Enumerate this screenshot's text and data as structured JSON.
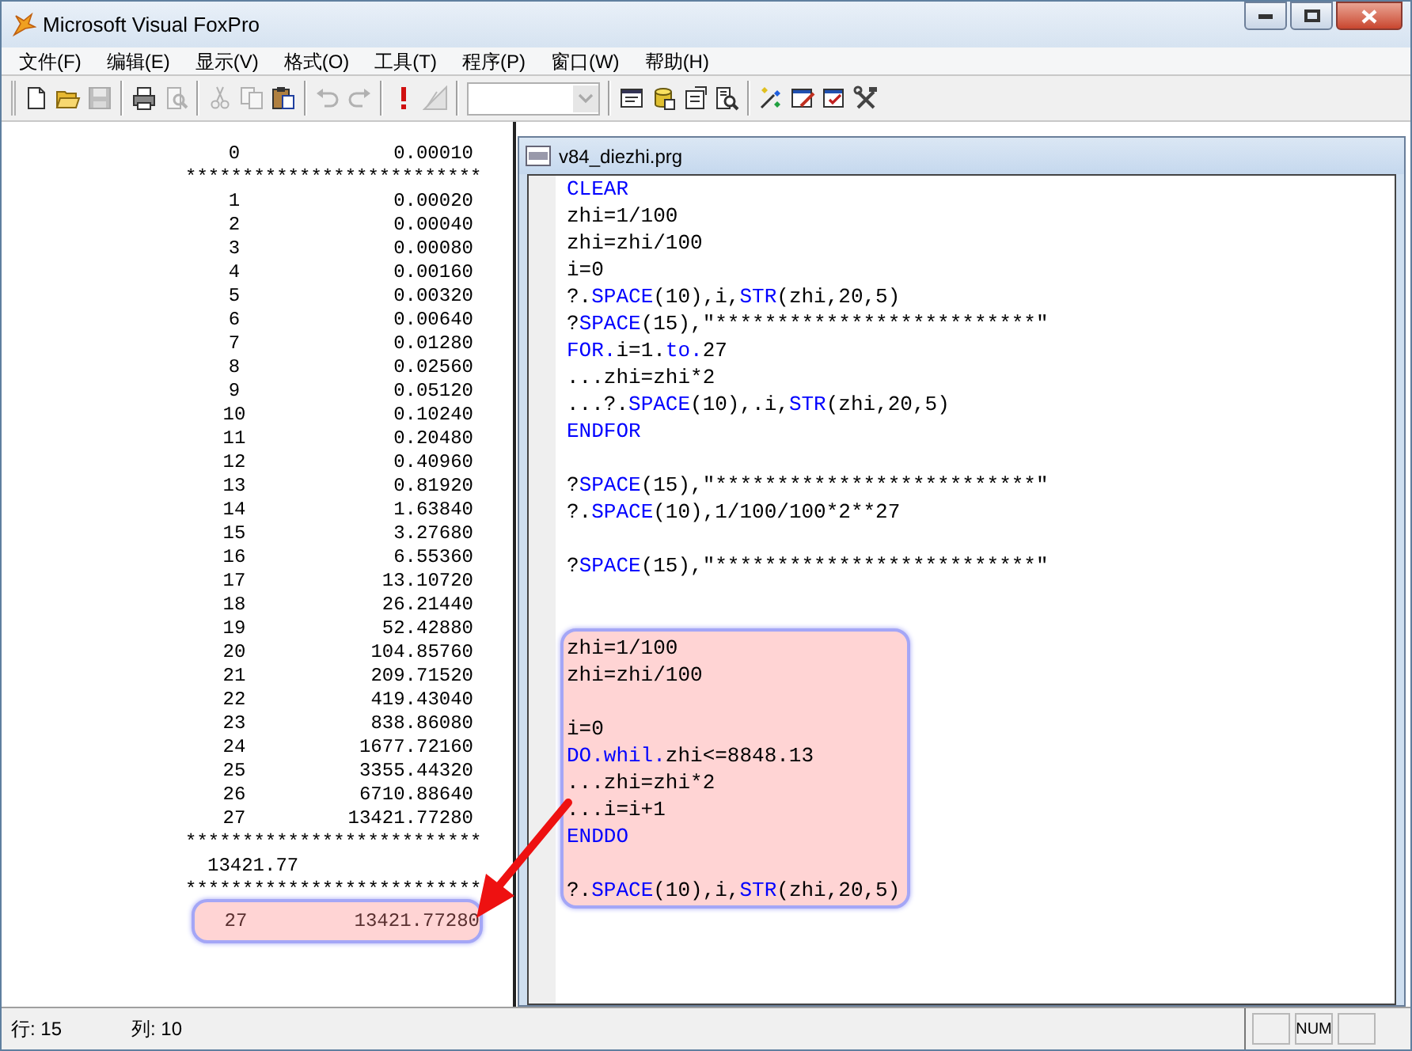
{
  "window": {
    "title": "Microsoft Visual FoxPro"
  },
  "menu": [
    "文件(F)",
    "编辑(E)",
    "显示(V)",
    "格式(O)",
    "工具(T)",
    "程序(P)",
    "窗口(W)",
    "帮助(H)"
  ],
  "toolbar": [
    {
      "kind": "new",
      "disabled": false
    },
    {
      "kind": "open",
      "disabled": false
    },
    {
      "kind": "save",
      "disabled": true
    },
    {
      "kind": "sep"
    },
    {
      "kind": "print",
      "disabled": false
    },
    {
      "kind": "preview",
      "disabled": true
    },
    {
      "kind": "sep"
    },
    {
      "kind": "cut",
      "disabled": true
    },
    {
      "kind": "copy",
      "disabled": true
    },
    {
      "kind": "paste",
      "disabled": false
    },
    {
      "kind": "sep"
    },
    {
      "kind": "undo",
      "disabled": true
    },
    {
      "kind": "redo",
      "disabled": true
    },
    {
      "kind": "sep"
    },
    {
      "kind": "run",
      "disabled": false
    },
    {
      "kind": "modify",
      "disabled": true
    },
    {
      "kind": "sep"
    },
    {
      "kind": "combo",
      "disabled": true
    },
    {
      "kind": "sep"
    },
    {
      "kind": "command",
      "disabled": false
    },
    {
      "kind": "database",
      "disabled": false
    },
    {
      "kind": "properties",
      "disabled": false
    },
    {
      "kind": "code",
      "disabled": false
    },
    {
      "kind": "sep"
    },
    {
      "kind": "wizard",
      "disabled": false
    },
    {
      "kind": "form",
      "disabled": false
    },
    {
      "kind": "formcheck",
      "disabled": false
    },
    {
      "kind": "tools",
      "disabled": false
    }
  ],
  "output": [
    {
      "kind": "row",
      "index": "0",
      "value": "0.00010",
      "highlighted": false
    },
    {
      "kind": "rule",
      "text": "**************************"
    },
    {
      "kind": "row",
      "index": "1",
      "value": "0.00020",
      "highlighted": false
    },
    {
      "kind": "row",
      "index": "2",
      "value": "0.00040",
      "highlighted": false
    },
    {
      "kind": "row",
      "index": "3",
      "value": "0.00080",
      "highlighted": false
    },
    {
      "kind": "row",
      "index": "4",
      "value": "0.00160",
      "highlighted": false
    },
    {
      "kind": "row",
      "index": "5",
      "value": "0.00320",
      "highlighted": false
    },
    {
      "kind": "row",
      "index": "6",
      "value": "0.00640",
      "highlighted": false
    },
    {
      "kind": "row",
      "index": "7",
      "value": "0.01280",
      "highlighted": false
    },
    {
      "kind": "row",
      "index": "8",
      "value": "0.02560",
      "highlighted": false
    },
    {
      "kind": "row",
      "index": "9",
      "value": "0.05120",
      "highlighted": false
    },
    {
      "kind": "row",
      "index": "10",
      "value": "0.10240",
      "highlighted": false
    },
    {
      "kind": "row",
      "index": "11",
      "value": "0.20480",
      "highlighted": false
    },
    {
      "kind": "row",
      "index": "12",
      "value": "0.40960",
      "highlighted": false
    },
    {
      "kind": "row",
      "index": "13",
      "value": "0.81920",
      "highlighted": false
    },
    {
      "kind": "row",
      "index": "14",
      "value": "1.63840",
      "highlighted": false
    },
    {
      "kind": "row",
      "index": "15",
      "value": "3.27680",
      "highlighted": false
    },
    {
      "kind": "row",
      "index": "16",
      "value": "6.55360",
      "highlighted": false
    },
    {
      "kind": "row",
      "index": "17",
      "value": "13.10720",
      "highlighted": false
    },
    {
      "kind": "row",
      "index": "18",
      "value": "26.21440",
      "highlighted": false
    },
    {
      "kind": "row",
      "index": "19",
      "value": "52.42880",
      "highlighted": false
    },
    {
      "kind": "row",
      "index": "20",
      "value": "104.85760",
      "highlighted": false
    },
    {
      "kind": "row",
      "index": "21",
      "value": "209.71520",
      "highlighted": false
    },
    {
      "kind": "row",
      "index": "22",
      "value": "419.43040",
      "highlighted": false
    },
    {
      "kind": "row",
      "index": "23",
      "value": "838.86080",
      "highlighted": false
    },
    {
      "kind": "row",
      "index": "24",
      "value": "1677.72160",
      "highlighted": false
    },
    {
      "kind": "row",
      "index": "25",
      "value": "3355.44320",
      "highlighted": false
    },
    {
      "kind": "row",
      "index": "26",
      "value": "6710.88640",
      "highlighted": false
    },
    {
      "kind": "row",
      "index": "27",
      "value": "13421.77280",
      "highlighted": false
    },
    {
      "kind": "rule",
      "text": "**************************"
    },
    {
      "kind": "total",
      "text": "13421.77"
    },
    {
      "kind": "rule",
      "text": "**************************"
    },
    {
      "kind": "row",
      "index": "27",
      "value": "13421.77280",
      "highlighted": true
    }
  ],
  "editor": {
    "title": "v84_diezhi.prg",
    "lines": [
      {
        "kind": "code",
        "segments": [
          {
            "text": "CLEAR",
            "kind": "kw"
          }
        ]
      },
      {
        "kind": "code",
        "segments": [
          {
            "text": "zhi=1/100",
            "kind": "plain"
          }
        ]
      },
      {
        "kind": "code",
        "segments": [
          {
            "text": "zhi=zhi/100",
            "kind": "plain"
          }
        ]
      },
      {
        "kind": "code",
        "segments": [
          {
            "text": "i=0",
            "kind": "plain"
          }
        ]
      },
      {
        "kind": "code",
        "segments": [
          {
            "text": "?.",
            "kind": "plain"
          },
          {
            "text": "SPACE",
            "kind": "kw"
          },
          {
            "text": "(10),i,",
            "kind": "plain"
          },
          {
            "text": "STR",
            "kind": "kw"
          },
          {
            "text": "(zhi,20,5)",
            "kind": "plain"
          }
        ]
      },
      {
        "kind": "code",
        "segments": [
          {
            "text": "?",
            "kind": "plain"
          },
          {
            "text": "SPACE",
            "kind": "kw"
          },
          {
            "text": "(15),″**************************″",
            "kind": "plain"
          }
        ]
      },
      {
        "kind": "code",
        "segments": [
          {
            "text": "FOR.",
            "kind": "kw"
          },
          {
            "text": "i=1.",
            "kind": "plain"
          },
          {
            "text": "to.",
            "kind": "kw"
          },
          {
            "text": "27",
            "kind": "plain"
          }
        ]
      },
      {
        "kind": "code",
        "segments": [
          {
            "text": "...zhi=zhi*2",
            "kind": "plain"
          }
        ]
      },
      {
        "kind": "code",
        "segments": [
          {
            "text": "...?.",
            "kind": "plain"
          },
          {
            "text": "SPACE",
            "kind": "kw"
          },
          {
            "text": "(10),.i,",
            "kind": "plain"
          },
          {
            "text": "STR",
            "kind": "kw"
          },
          {
            "text": "(zhi,20,5)",
            "kind": "plain"
          }
        ]
      },
      {
        "kind": "code",
        "segments": [
          {
            "text": "ENDFOR",
            "kind": "kw"
          }
        ]
      },
      {
        "kind": "blank"
      },
      {
        "kind": "code",
        "segments": [
          {
            "text": "?",
            "kind": "plain"
          },
          {
            "text": "SPACE",
            "kind": "kw"
          },
          {
            "text": "(15),″**************************″",
            "kind": "plain"
          }
        ]
      },
      {
        "kind": "code",
        "segments": [
          {
            "text": "?.",
            "kind": "plain"
          },
          {
            "text": "SPACE",
            "kind": "kw"
          },
          {
            "text": "(10),1/100/100*2**27",
            "kind": "plain"
          }
        ]
      },
      {
        "kind": "blank"
      },
      {
        "kind": "code",
        "segments": [
          {
            "text": "?",
            "kind": "plain"
          },
          {
            "text": "SPACE",
            "kind": "kw"
          },
          {
            "text": "(15),″**************************″",
            "kind": "plain"
          }
        ]
      },
      {
        "kind": "blank"
      },
      {
        "kind": "blank"
      }
    ],
    "callout": [
      {
        "kind": "code",
        "segments": [
          {
            "text": "zhi=1/100",
            "kind": "plain"
          }
        ]
      },
      {
        "kind": "code",
        "segments": [
          {
            "text": "zhi=zhi/100",
            "kind": "plain"
          }
        ]
      },
      {
        "kind": "blank"
      },
      {
        "kind": "code",
        "segments": [
          {
            "text": "i=0",
            "kind": "plain"
          }
        ]
      },
      {
        "kind": "code",
        "segments": [
          {
            "text": "DO.",
            "kind": "kw"
          },
          {
            "text": "whil.",
            "kind": "kw"
          },
          {
            "text": "zhi<=8848.13",
            "kind": "plain"
          }
        ]
      },
      {
        "kind": "code",
        "segments": [
          {
            "text": "...zhi=zhi*2",
            "kind": "plain"
          }
        ]
      },
      {
        "kind": "code",
        "segments": [
          {
            "text": "...i=i+1",
            "kind": "plain"
          }
        ]
      },
      {
        "kind": "code",
        "segments": [
          {
            "text": "ENDDO",
            "kind": "kw"
          }
        ]
      },
      {
        "kind": "blank"
      },
      {
        "kind": "code",
        "segments": [
          {
            "text": "?.",
            "kind": "plain"
          },
          {
            "text": "SPACE",
            "kind": "kw"
          },
          {
            "text": "(10),i,",
            "kind": "plain"
          },
          {
            "text": "STR",
            "kind": "kw"
          },
          {
            "text": "(zhi,20,5)",
            "kind": "plain"
          }
        ]
      }
    ]
  },
  "status_bar": {
    "row": "行: 15",
    "column": "列: 10",
    "indicators": [
      {
        "kind": "empty"
      },
      {
        "kind": "text",
        "text": "NUM"
      },
      {
        "kind": "empty"
      }
    ]
  }
}
